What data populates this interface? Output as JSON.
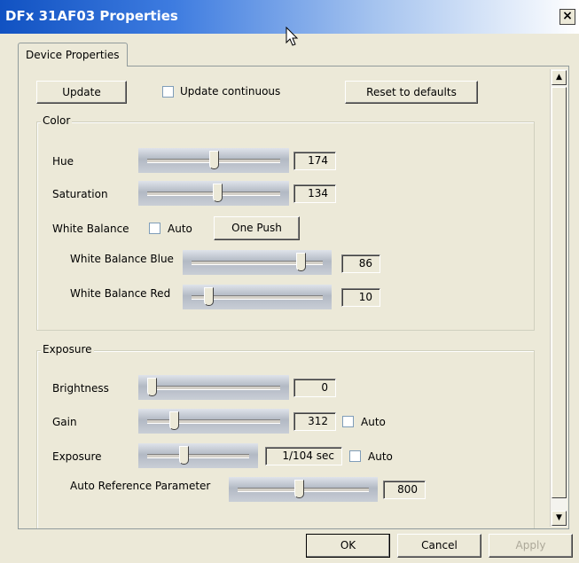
{
  "window": {
    "title": "DFx 31AF03 Properties",
    "close_glyph": "×"
  },
  "tabs": [
    {
      "label": "Device Properties"
    }
  ],
  "top": {
    "update_label": "Update",
    "update_continuous_label": "Update continuous",
    "update_continuous_checked": false,
    "reset_label": "Reset to defaults"
  },
  "color": {
    "title": "Color",
    "hue": {
      "label": "Hue",
      "value": "174",
      "level": 0.5
    },
    "saturation": {
      "label": "Saturation",
      "value": "134",
      "level": 0.53
    },
    "white_balance": {
      "label": "White Balance",
      "auto_label": "Auto",
      "auto_checked": false,
      "one_push_label": "One Push",
      "blue": {
        "label": "White Balance Blue",
        "value": "86",
        "level": 0.86
      },
      "red": {
        "label": "White Balance Red",
        "value": "10",
        "level": 0.1
      }
    }
  },
  "exposure": {
    "title": "Exposure",
    "brightness": {
      "label": "Brightness",
      "value": "0",
      "level": 0.0
    },
    "gain": {
      "label": "Gain",
      "value": "312",
      "level": 0.18,
      "auto_label": "Auto",
      "auto_checked": false
    },
    "exposure": {
      "label": "Exposure",
      "value": "1/104 sec",
      "level": 0.35,
      "auto_label": "Auto",
      "auto_checked": false
    },
    "auto_reference": {
      "label": "Auto Reference Parameter",
      "value": "800",
      "level": 0.47
    }
  },
  "footer": {
    "ok_label": "OK",
    "cancel_label": "Cancel",
    "apply_label": "Apply",
    "apply_enabled": false
  },
  "icons": {
    "scroll_up": "scroll-up-icon",
    "scroll_down": "scroll-down-icon",
    "cursor": "mouse-cursor-icon"
  }
}
